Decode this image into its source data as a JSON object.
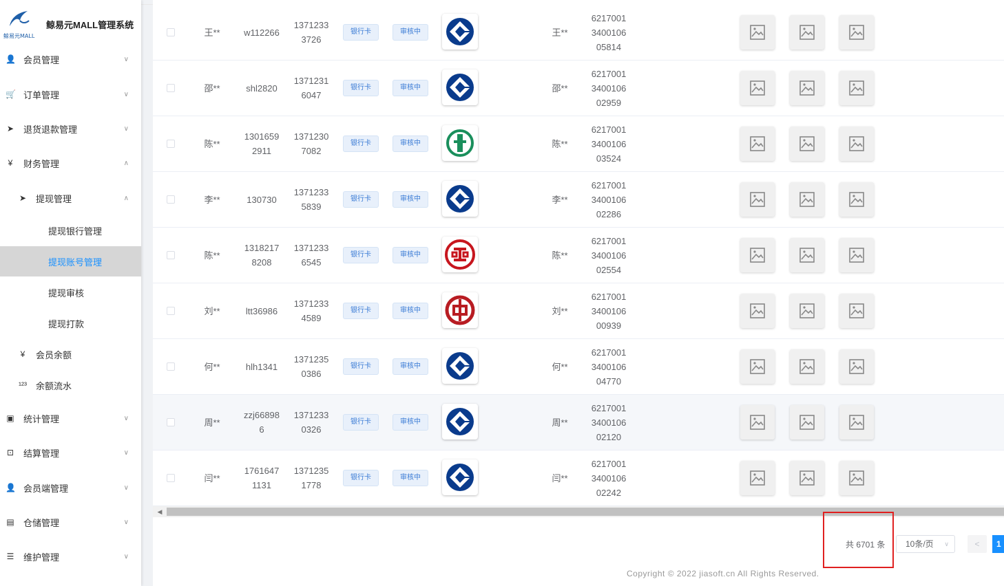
{
  "app": {
    "title": "鲸易元MALL管理系统",
    "logo_sub": "鲸易元MALL"
  },
  "sidebar": {
    "items": [
      {
        "label": "会员管理",
        "icon": "user-icon",
        "glyph": "👤"
      },
      {
        "label": "订单管理",
        "icon": "cart-icon",
        "glyph": "🛒"
      },
      {
        "label": "退货退款管理",
        "icon": "send-icon",
        "glyph": "➤"
      },
      {
        "label": "财务管理",
        "icon": "yen-icon",
        "glyph": "¥"
      },
      {
        "label": "提现管理",
        "icon": "send-icon",
        "glyph": "➤"
      },
      {
        "label": "提现银行管理"
      },
      {
        "label": "提现账号管理"
      },
      {
        "label": "提现审核"
      },
      {
        "label": "提现打款"
      },
      {
        "label": "会员余额",
        "icon": "yen-icon",
        "glyph": "¥"
      },
      {
        "label": "余额流水",
        "icon": "number-icon",
        "glyph": "¹²³"
      },
      {
        "label": "统计管理",
        "icon": "chart-icon",
        "glyph": "▣"
      },
      {
        "label": "结算管理",
        "icon": "settlement-icon",
        "glyph": "⊡"
      },
      {
        "label": "会员端管理",
        "icon": "user-icon",
        "glyph": "👤"
      },
      {
        "label": "仓储管理",
        "icon": "warehouse-icon",
        "glyph": "▤"
      },
      {
        "label": "维护管理",
        "icon": "sliders-icon",
        "glyph": "☰"
      }
    ]
  },
  "table": {
    "rows": [
      {
        "name": "王**",
        "account": "w112266",
        "phone": [
          "1371233",
          "3726"
        ],
        "type": "银行卡",
        "status": "审核中",
        "bank": "ccb",
        "holder": "王**",
        "card": [
          "6217001",
          "3400106",
          "05814"
        ]
      },
      {
        "name": "邵**",
        "account": "shl2820",
        "phone": [
          "1371231",
          "6047"
        ],
        "type": "银行卡",
        "status": "审核中",
        "bank": "ccb",
        "holder": "邵**",
        "card": [
          "6217001",
          "3400106",
          "02959"
        ]
      },
      {
        "name": "陈**",
        "account": [
          "1301659",
          "2911"
        ],
        "phone": [
          "1371230",
          "7082"
        ],
        "type": "银行卡",
        "status": "审核中",
        "bank": "abc",
        "holder": "陈**",
        "card": [
          "6217001",
          "3400106",
          "03524"
        ]
      },
      {
        "name": "李**",
        "account": "130730",
        "phone": [
          "1371233",
          "5839"
        ],
        "type": "银行卡",
        "status": "审核中",
        "bank": "ccb",
        "holder": "李**",
        "card": [
          "6217001",
          "3400106",
          "02286"
        ]
      },
      {
        "name": "陈**",
        "account": [
          "1318217",
          "8208"
        ],
        "phone": [
          "1371233",
          "6545"
        ],
        "type": "银行卡",
        "status": "审核中",
        "bank": "icbc",
        "holder": "陈**",
        "card": [
          "6217001",
          "3400106",
          "02554"
        ]
      },
      {
        "name": "刘**",
        "account": "ltt36986",
        "phone": [
          "1371233",
          "4589"
        ],
        "type": "银行卡",
        "status": "审核中",
        "bank": "boc",
        "holder": "刘**",
        "card": [
          "6217001",
          "3400106",
          "00939"
        ]
      },
      {
        "name": "何**",
        "account": "hlh1341",
        "phone": [
          "1371235",
          "0386"
        ],
        "type": "银行卡",
        "status": "审核中",
        "bank": "ccb",
        "holder": "何**",
        "card": [
          "6217001",
          "3400106",
          "04770"
        ]
      },
      {
        "name": "周**",
        "account": [
          "zzj66898",
          "6"
        ],
        "phone": [
          "1371233",
          "0326"
        ],
        "type": "银行卡",
        "status": "审核中",
        "bank": "ccb",
        "holder": "周**",
        "card": [
          "6217001",
          "3400106",
          "02120"
        ]
      },
      {
        "name": "闫**",
        "account": [
          "1761647",
          "1131"
        ],
        "phone": [
          "1371235",
          "1778"
        ],
        "type": "银行卡",
        "status": "审核中",
        "bank": "ccb",
        "holder": "闫**",
        "card": [
          "6217001",
          "3400106",
          "02242"
        ]
      }
    ]
  },
  "pagination": {
    "total": "共 6701 条",
    "page_size": "10条/页",
    "current_page": "1"
  },
  "footer": {
    "copyright": "Copyright © 2022 jiasoft.cn All Rights Reserved."
  },
  "colors": {
    "primary": "#1890ff",
    "highlight_box": "#e02020",
    "ccb": "#0a3b8c",
    "abc": "#1a8f5c",
    "icbc": "#c7161e",
    "boc": "#b81c22"
  }
}
